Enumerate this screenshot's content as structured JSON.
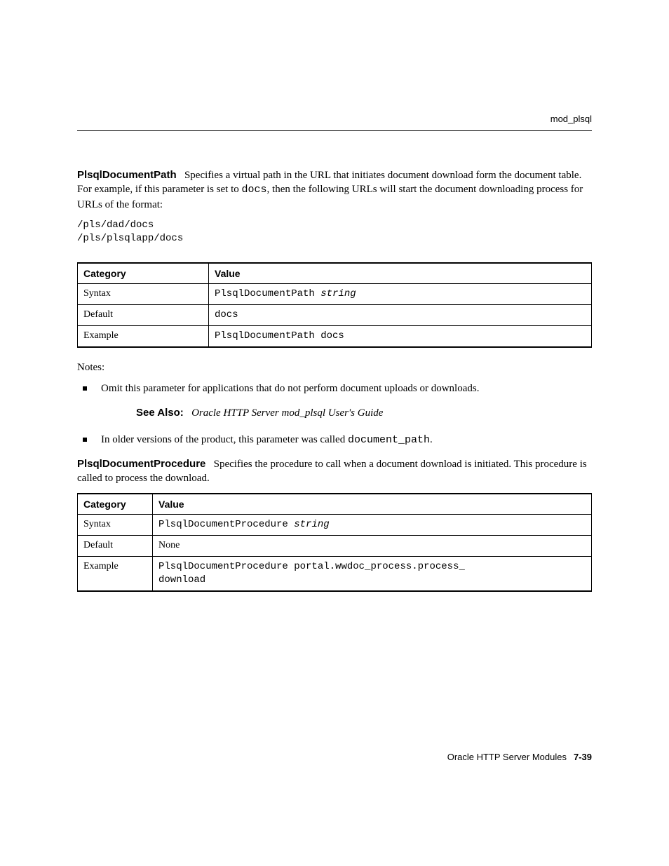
{
  "header": {
    "section": "mod_plsql"
  },
  "section1": {
    "heading": "PlsqlDocumentPath",
    "intro_before_mono": "Specifies a virtual path in the URL that initiates document download form the document table. For example, if this parameter is set to ",
    "intro_mono": "docs",
    "intro_after_mono": ", then the following URLs will start the document downloading process for URLs of the format:",
    "code": "/pls/dad/docs\n/pls/plsqlapp/docs",
    "table": {
      "head_cat": "Category",
      "head_val": "Value",
      "rows": [
        {
          "cat": "Syntax",
          "val_mono": "PlsqlDocumentPath ",
          "val_italic": "string"
        },
        {
          "cat": "Default",
          "val_mono": "docs",
          "val_italic": ""
        },
        {
          "cat": "Example",
          "val_mono": "PlsqlDocumentPath docs",
          "val_italic": ""
        }
      ]
    },
    "notes_label": "Notes:",
    "bullet1": "Omit this parameter for applications that do not perform document uploads or downloads.",
    "seealso_label": "See Also:",
    "seealso_text": "Oracle HTTP Server mod_plsql User's Guide",
    "bullet2_before": "In older versions of the product, this parameter was called ",
    "bullet2_mono": "document_path",
    "bullet2_after": "."
  },
  "section2": {
    "heading": "PlsqlDocumentProcedure",
    "intro": "Specifies the procedure to call when a document download is initiated. This procedure is called to process the download.",
    "table": {
      "head_cat": "Category",
      "head_val": "Value",
      "rows": [
        {
          "cat": "Syntax",
          "val_mono": "PlsqlDocumentProcedure ",
          "val_italic": "string"
        },
        {
          "cat": "Default",
          "val_plain": "None"
        },
        {
          "cat": "Example",
          "val_mono": "PlsqlDocumentProcedure portal.wwdoc_process.process_\ndownload"
        }
      ]
    }
  },
  "footer": {
    "text": "Oracle HTTP Server Modules",
    "page": "7-39"
  }
}
